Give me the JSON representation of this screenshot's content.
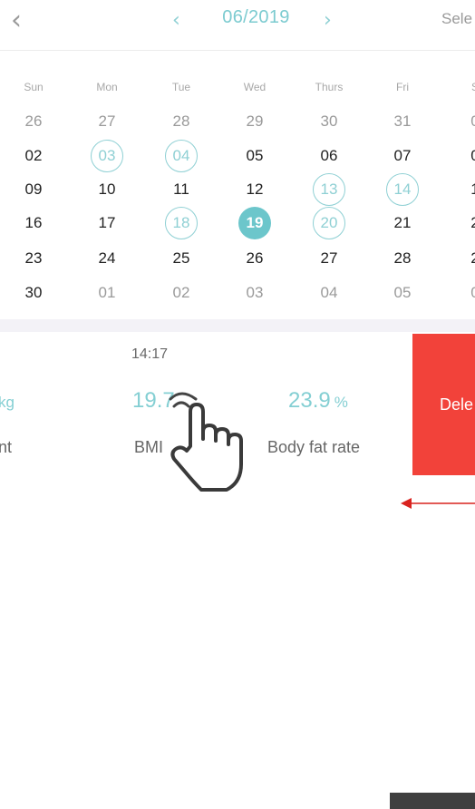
{
  "header": {
    "back_icon": "chevron-left-icon",
    "prev_icon": "chevron-left-icon",
    "month": "06/2019",
    "next_icon": "chevron-right-icon",
    "select_label": "Sele"
  },
  "calendar": {
    "weekdays": [
      "Sun",
      "Mon",
      "Tue",
      "Wed",
      "Thurs",
      "Fri",
      "S"
    ],
    "weeks": [
      [
        {
          "t": "26",
          "s": "other"
        },
        {
          "t": "27",
          "s": "other"
        },
        {
          "t": "28",
          "s": "other"
        },
        {
          "t": "29",
          "s": "other"
        },
        {
          "t": "30",
          "s": "other"
        },
        {
          "t": "31",
          "s": "other"
        },
        {
          "t": "0",
          "s": "other"
        }
      ],
      [
        {
          "t": "02",
          "s": "normal"
        },
        {
          "t": "03",
          "s": "ringed"
        },
        {
          "t": "04",
          "s": "ringed"
        },
        {
          "t": "05",
          "s": "normal"
        },
        {
          "t": "06",
          "s": "normal"
        },
        {
          "t": "07",
          "s": "normal"
        },
        {
          "t": "0",
          "s": "normal"
        }
      ],
      [
        {
          "t": "09",
          "s": "normal"
        },
        {
          "t": "10",
          "s": "normal"
        },
        {
          "t": "11",
          "s": "normal"
        },
        {
          "t": "12",
          "s": "normal"
        },
        {
          "t": "13",
          "s": "ringed"
        },
        {
          "t": "14",
          "s": "ringed"
        },
        {
          "t": "1",
          "s": "normal"
        }
      ],
      [
        {
          "t": "16",
          "s": "normal"
        },
        {
          "t": "17",
          "s": "normal"
        },
        {
          "t": "18",
          "s": "ringed"
        },
        {
          "t": "19",
          "s": "selected"
        },
        {
          "t": "20",
          "s": "ringed"
        },
        {
          "t": "21",
          "s": "normal"
        },
        {
          "t": "2",
          "s": "normal"
        }
      ],
      [
        {
          "t": "23",
          "s": "normal"
        },
        {
          "t": "24",
          "s": "normal"
        },
        {
          "t": "25",
          "s": "normal"
        },
        {
          "t": "26",
          "s": "normal"
        },
        {
          "t": "27",
          "s": "normal"
        },
        {
          "t": "28",
          "s": "normal"
        },
        {
          "t": "2",
          "s": "normal"
        }
      ],
      [
        {
          "t": "30",
          "s": "normal"
        },
        {
          "t": "01",
          "s": "other"
        },
        {
          "t": "02",
          "s": "other"
        },
        {
          "t": "03",
          "s": "other"
        },
        {
          "t": "04",
          "s": "other"
        },
        {
          "t": "05",
          "s": "other"
        },
        {
          "t": "0",
          "s": "other"
        }
      ]
    ]
  },
  "record": {
    "time": "14:17",
    "weight_unit": "kg",
    "weight_label": "nt",
    "bmi_value": "19.7",
    "bmi_label": "BMI",
    "bodyfat_value": "23.9",
    "bodyfat_unit": "%",
    "bodyfat_label": "Body fat rate",
    "delete_label": "Dele"
  },
  "overlay": {
    "hand_icon": "pointing-hand-icon",
    "arrow_icon": "left-arrow-icon"
  },
  "colors": {
    "accent": "#6cc6cb",
    "delete": "#f2423a",
    "arrow": "#d9231f"
  }
}
